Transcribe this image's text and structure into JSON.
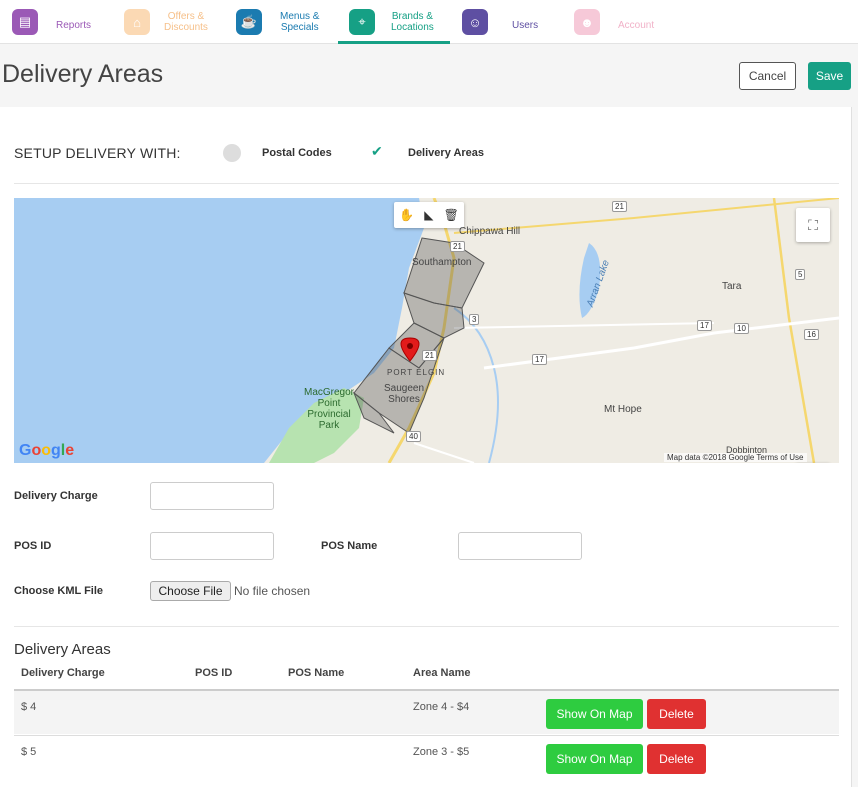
{
  "nav": {
    "items": [
      {
        "label": "Reports",
        "color": "#9b59b6",
        "icon": "reports-icon",
        "label_color": "#9b59b6"
      },
      {
        "label": "Offers &\nDiscounts",
        "color": "#f6c08a",
        "icon": "offers-icon",
        "label_color": "#f6c08a"
      },
      {
        "label": "Menus &\nSpecials",
        "color": "#1b7bb0",
        "icon": "menus-icon",
        "label_color": "#1b7bb0"
      },
      {
        "label": "Brands &\nLocations",
        "color": "#16a085",
        "icon": "location-pin-icon",
        "label_color": "#16a085"
      },
      {
        "label": "Users",
        "color": "#5e4fa2",
        "icon": "user-icon",
        "label_color": "#5e4fa2"
      },
      {
        "label": "Account",
        "color": "#f1b2c8",
        "icon": "account-icon",
        "label_color": "#f1b2c8"
      }
    ],
    "active_index": 3
  },
  "header": {
    "title": "Delivery Areas",
    "cancel_label": "Cancel",
    "save_label": "Save"
  },
  "setup": {
    "label": "SETUP DELIVERY WITH:",
    "option_postal": "Postal Codes",
    "option_areas": "Delivery Areas",
    "selected": "Delivery Areas"
  },
  "map": {
    "places": {
      "chippawa_hill": "Chippawa Hill",
      "southampton": "Southampton",
      "arran_lake": "Arran Lake",
      "tara": "Tara",
      "port_elgin": "PORT ELGIN",
      "saugeen_shores": "Saugeen\nShores",
      "macgregor": "MacGregor\nPoint\nProvincial\nPark",
      "mt_hope": "Mt Hope",
      "dobbinton": "Dobbinton"
    },
    "routes": {
      "r21a": "21",
      "r21b": "21",
      "r21c": "21",
      "r3": "3",
      "r5": "5",
      "r17a": "17",
      "r17b": "17",
      "r10": "10",
      "r16": "16",
      "r40": "40"
    },
    "google_logo": "Google",
    "attribution": "Map data ©2018 Google    Terms of Use",
    "zoom_in": "+",
    "zoom_out": "−"
  },
  "form": {
    "delivery_charge_label": "Delivery Charge",
    "delivery_charge_value": "",
    "pos_id_label": "POS ID",
    "pos_id_value": "",
    "pos_name_label": "POS Name",
    "pos_name_value": "",
    "kml_label": "Choose KML File",
    "choose_file_label": "Choose File",
    "file_status": "No file chosen"
  },
  "table": {
    "title": "Delivery Areas",
    "headers": [
      "Delivery Charge",
      "POS ID",
      "POS Name",
      "Area Name"
    ],
    "rows": [
      {
        "charge": "$ 4",
        "pos_id": "",
        "pos_name": "",
        "area": "Zone 4 - $4",
        "show_label": "Show On Map",
        "delete_label": "Delete"
      },
      {
        "charge": "$ 5",
        "pos_id": "",
        "pos_name": "",
        "area": "Zone 3 - $5",
        "show_label": "Show On Map",
        "delete_label": "Delete"
      }
    ]
  }
}
